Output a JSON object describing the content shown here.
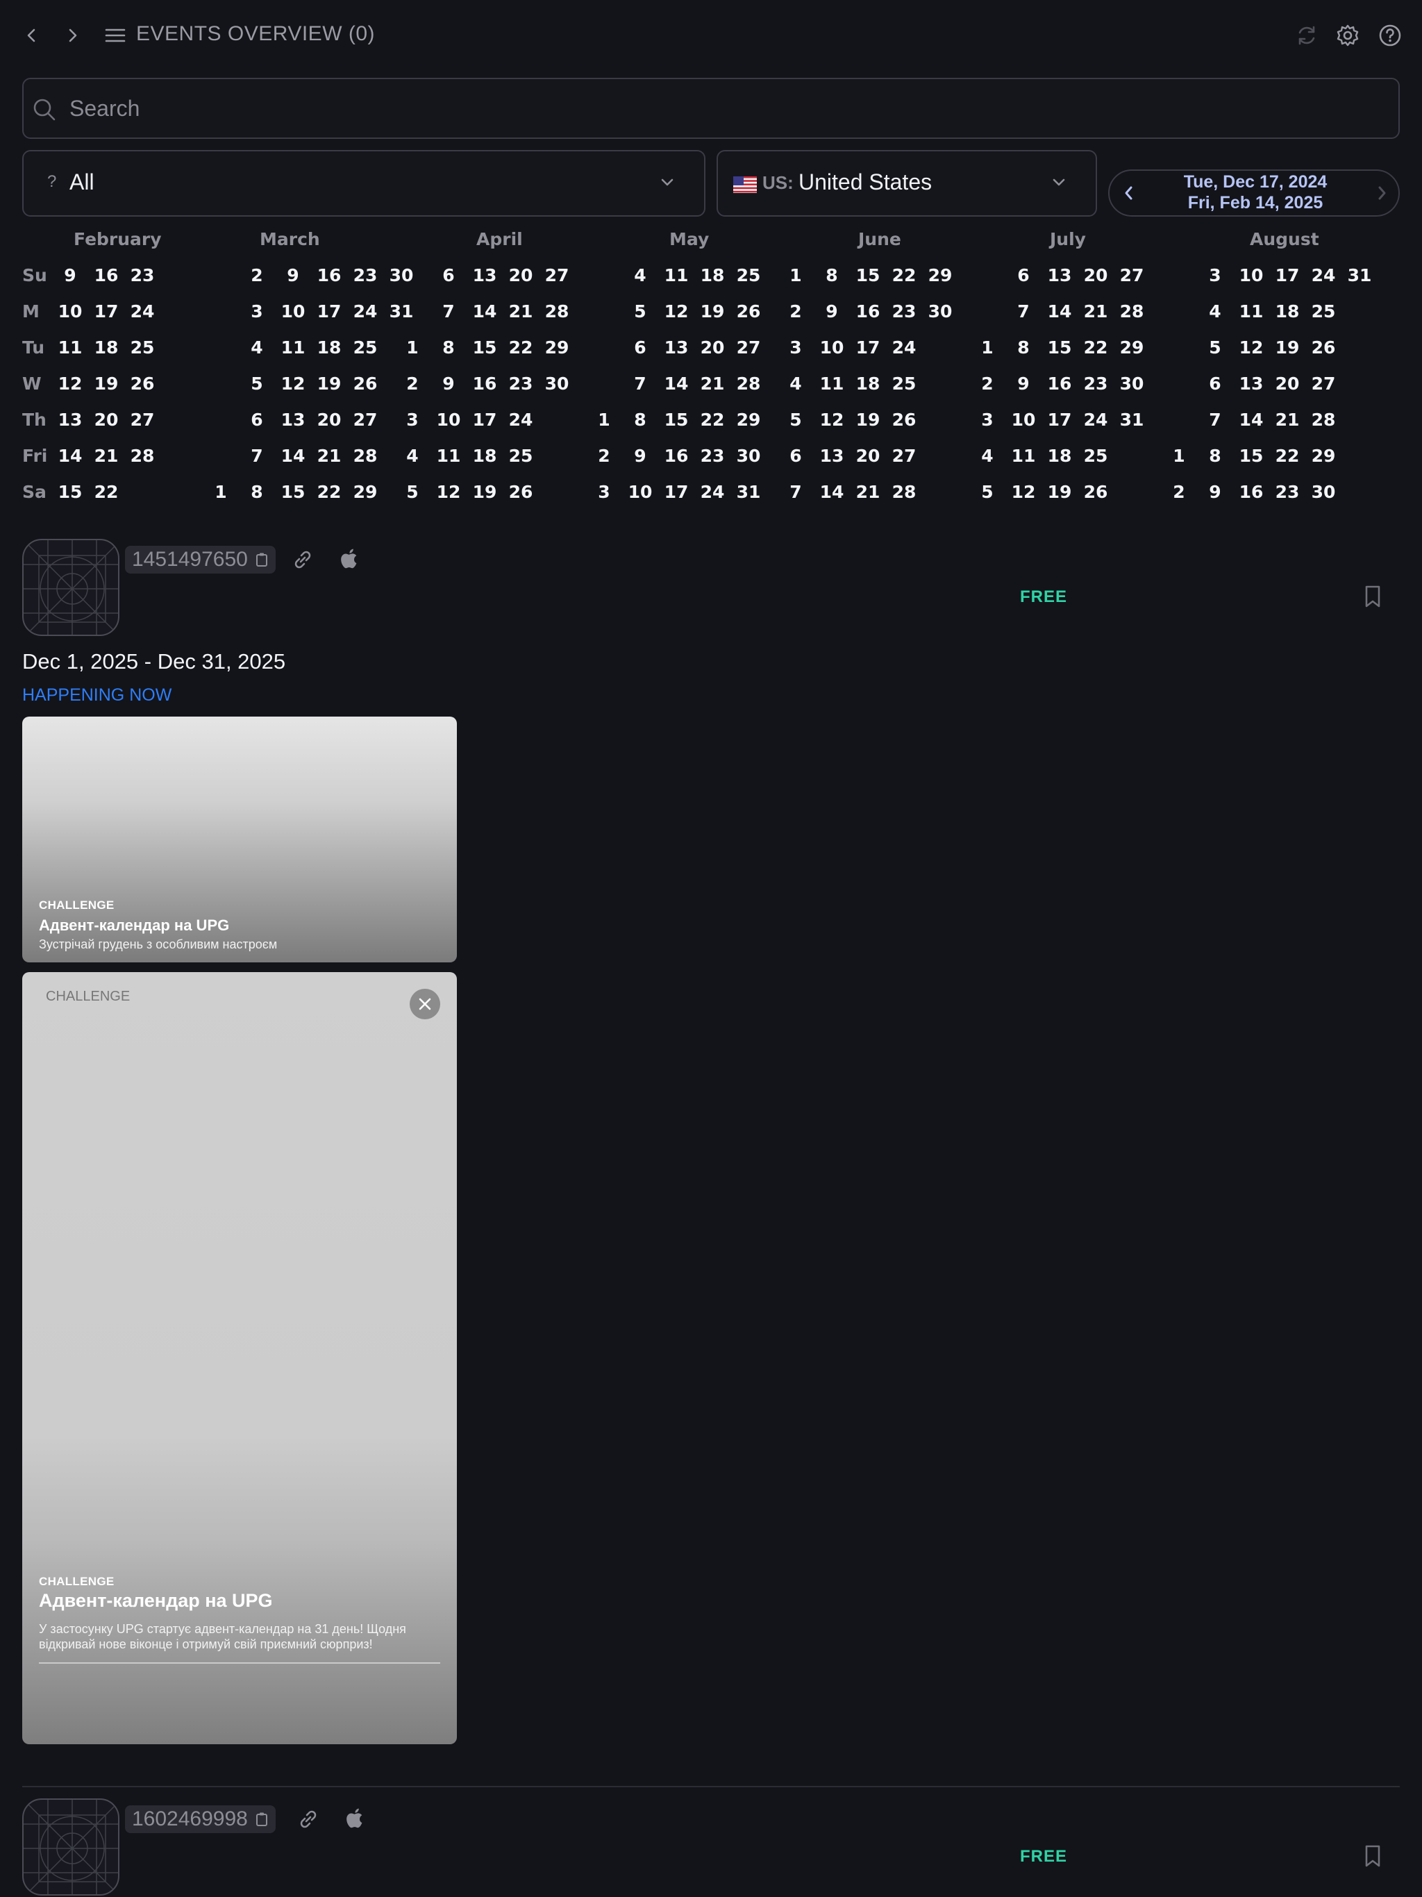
{
  "header": {
    "title": "EVENTS OVERVIEW (0)",
    "icons": [
      "chevron-left-icon",
      "chevron-right-icon",
      "hamburger-menu-icon",
      "refresh-icon",
      "settings-gear-icon",
      "help-question-icon"
    ]
  },
  "search": {
    "placeholder": "Search",
    "value": ""
  },
  "filters": {
    "type_prefix": "?",
    "type_value": "All",
    "country_code": "US:",
    "country_name": "United States"
  },
  "date_range": {
    "start": "Tue, Dec 17, 2024",
    "end": "Fri, Feb 14, 2025"
  },
  "calendar": {
    "weekdays": [
      "Su",
      "M",
      "Tu",
      "W",
      "Th",
      "Fri",
      "Sa"
    ],
    "months": [
      {
        "name": "February",
        "weeks": [
          [
            "9",
            "10",
            "11",
            "12",
            "13",
            "14",
            "15"
          ],
          [
            "16",
            "17",
            "18",
            "19",
            "20",
            "21",
            "22"
          ],
          [
            "23",
            "24",
            "25",
            "26",
            "27",
            "28",
            ""
          ]
        ]
      },
      {
        "name": "March",
        "weeks": [
          [
            "",
            "",
            "",
            "",
            "",
            "",
            "1"
          ],
          [
            "2",
            "3",
            "4",
            "5",
            "6",
            "7",
            "8"
          ],
          [
            "9",
            "10",
            "11",
            "12",
            "13",
            "14",
            "15"
          ],
          [
            "16",
            "17",
            "18",
            "19",
            "20",
            "21",
            "22"
          ],
          [
            "23",
            "24",
            "25",
            "26",
            "27",
            "28",
            "29"
          ],
          [
            "30",
            "31",
            "",
            "",
            "",
            "",
            ""
          ]
        ]
      },
      {
        "name": "April",
        "weeks": [
          [
            "",
            "",
            "1",
            "2",
            "3",
            "4",
            "5"
          ],
          [
            "6",
            "7",
            "8",
            "9",
            "10",
            "11",
            "12"
          ],
          [
            "13",
            "14",
            "15",
            "16",
            "17",
            "18",
            "19"
          ],
          [
            "20",
            "21",
            "22",
            "23",
            "24",
            "25",
            "26"
          ],
          [
            "27",
            "28",
            "29",
            "30",
            "",
            "",
            ""
          ]
        ]
      },
      {
        "name": "May",
        "weeks": [
          [
            "",
            "",
            "",
            "",
            "1",
            "2",
            "3"
          ],
          [
            "4",
            "5",
            "6",
            "7",
            "8",
            "9",
            "10"
          ],
          [
            "11",
            "12",
            "13",
            "14",
            "15",
            "16",
            "17"
          ],
          [
            "18",
            "19",
            "20",
            "21",
            "22",
            "23",
            "24"
          ],
          [
            "25",
            "26",
            "27",
            "28",
            "29",
            "30",
            "31"
          ]
        ]
      },
      {
        "name": "June",
        "weeks": [
          [
            "1",
            "2",
            "3",
            "4",
            "5",
            "6",
            "7"
          ],
          [
            "8",
            "9",
            "10",
            "11",
            "12",
            "13",
            "14"
          ],
          [
            "15",
            "16",
            "17",
            "18",
            "19",
            "20",
            "21"
          ],
          [
            "22",
            "23",
            "24",
            "25",
            "26",
            "27",
            "28"
          ],
          [
            "29",
            "30",
            "",
            "",
            "",
            "",
            ""
          ]
        ]
      },
      {
        "name": "July",
        "weeks": [
          [
            "",
            "",
            "1",
            "2",
            "3",
            "4",
            "5"
          ],
          [
            "6",
            "7",
            "8",
            "9",
            "10",
            "11",
            "12"
          ],
          [
            "13",
            "14",
            "15",
            "16",
            "17",
            "18",
            "19"
          ],
          [
            "20",
            "21",
            "22",
            "23",
            "24",
            "25",
            "26"
          ],
          [
            "27",
            "28",
            "29",
            "30",
            "31",
            "",
            ""
          ]
        ]
      },
      {
        "name": "August",
        "weeks": [
          [
            "",
            "",
            "",
            "",
            "",
            "1",
            "2"
          ],
          [
            "3",
            "4",
            "5",
            "6",
            "7",
            "8",
            "9"
          ],
          [
            "10",
            "11",
            "12",
            "13",
            "14",
            "15",
            "16"
          ],
          [
            "17",
            "18",
            "19",
            "20",
            "21",
            "22",
            "23"
          ],
          [
            "24",
            "25",
            "26",
            "27",
            "28",
            "29",
            "30"
          ],
          [
            "31",
            "",
            "",
            "",
            "",
            "",
            ""
          ]
        ]
      }
    ]
  },
  "apps": [
    {
      "id": "1451497650",
      "price": "FREE",
      "event": {
        "dates": "Dec 1, 2025 - Dec 31, 2025",
        "status": "HAPPENING NOW",
        "card_small": {
          "tag": "CHALLENGE",
          "title": "Адвент-календар на UPG",
          "subtitle": "Зустрічай грудень з особливим настроєм"
        },
        "card_large": {
          "top_tag": "CHALLENGE",
          "tag": "CHALLENGE",
          "title": "Адвент-календар на UPG",
          "description_line1": "У застосунку UPG стартує адвент-календар на 31 день! Щодня",
          "description_line2": "відкривай нове віконце і отримуй свій приємний сюрприз!"
        }
      }
    },
    {
      "id": "1602469998",
      "price": "FREE"
    }
  ],
  "colors": {
    "background": "#13141a",
    "free": "#2fd3a5",
    "happening_now": "#2f7df6",
    "date_pill": "#b6c4f5"
  }
}
